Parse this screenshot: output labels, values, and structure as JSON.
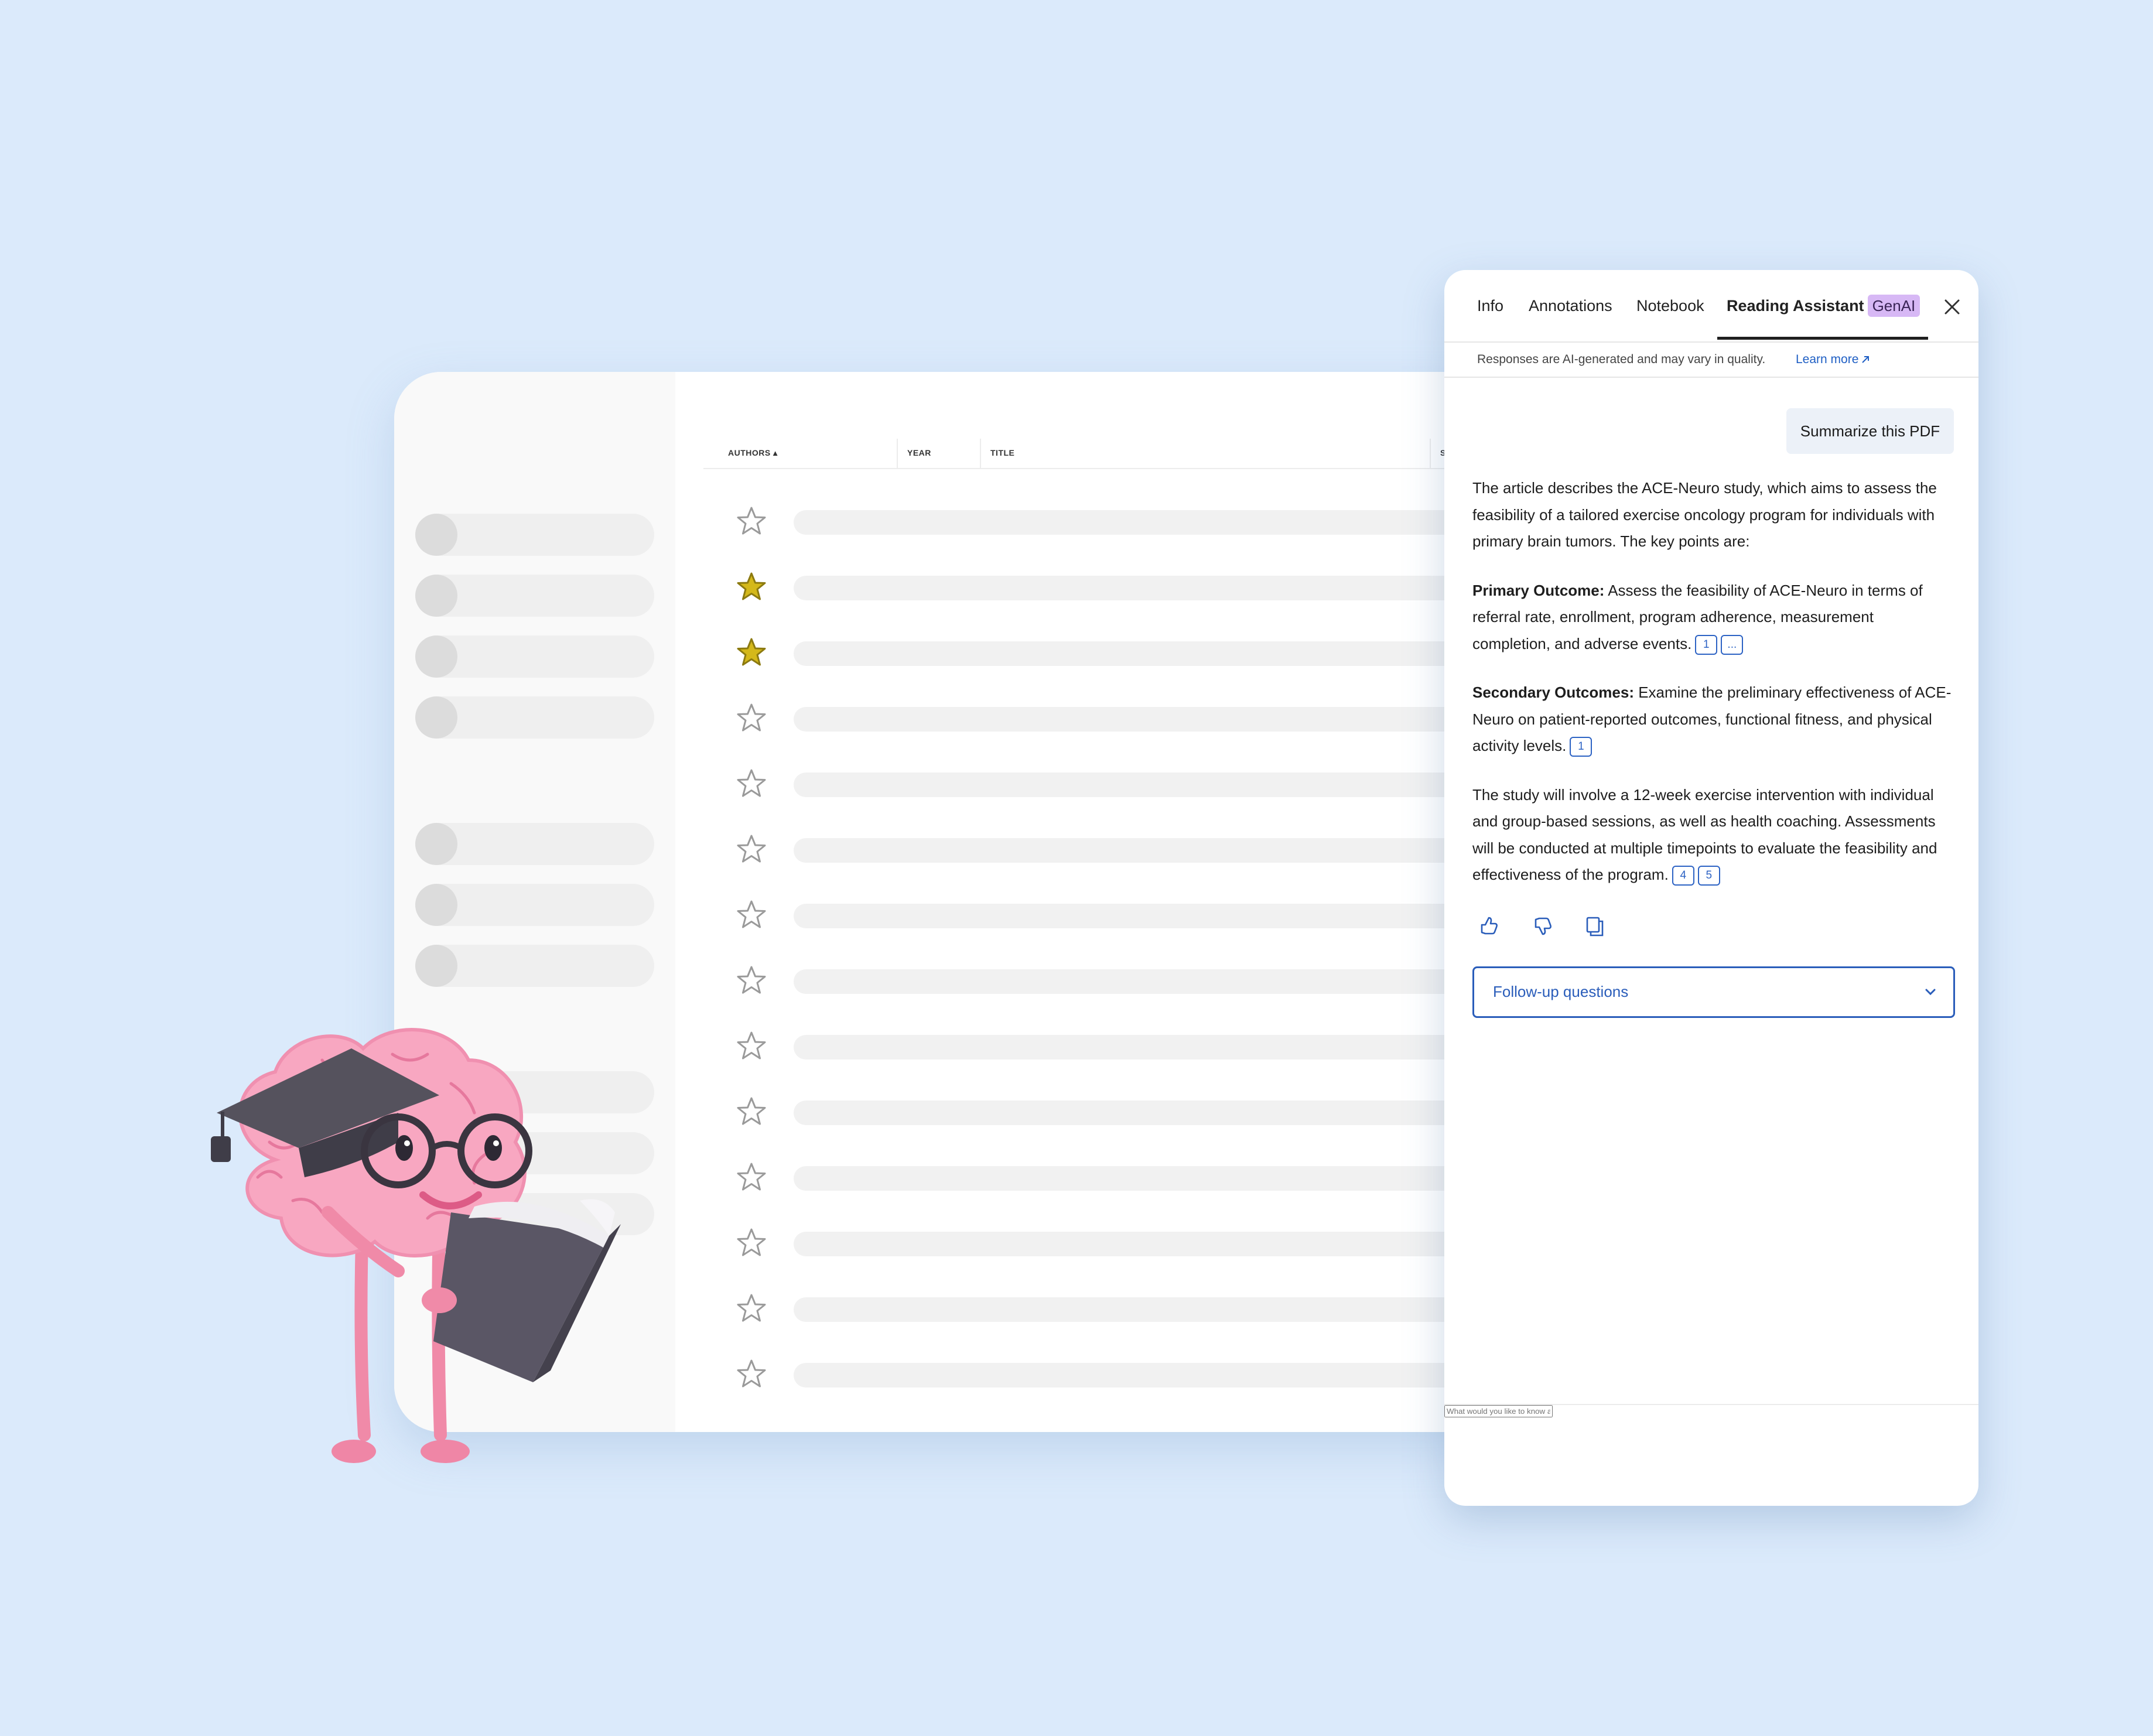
{
  "library": {
    "columns": [
      "AUTHORS ▴",
      "YEAR",
      "TITLE",
      "SOU"
    ],
    "rows": [
      {
        "starred": false
      },
      {
        "starred": true
      },
      {
        "starred": true
      },
      {
        "starred": false
      },
      {
        "starred": false
      },
      {
        "starred": false
      },
      {
        "starred": false
      },
      {
        "starred": false
      },
      {
        "starred": false
      },
      {
        "starred": false
      },
      {
        "starred": false
      },
      {
        "starred": false
      },
      {
        "starred": false
      },
      {
        "starred": false
      }
    ],
    "star_color": "#d4b81a"
  },
  "panel": {
    "tabs": [
      {
        "label": "Info"
      },
      {
        "label": "Annotations"
      },
      {
        "label": "Notebook"
      },
      {
        "label": "Reading Assistant",
        "badge": "GenAI",
        "active": true
      }
    ],
    "disclaimer": "Responses are AI-generated and may vary in quality.",
    "learn_more": "Learn more",
    "summarize_button": "Summarize this PDF",
    "answer": {
      "intro": "The article describes the ACE-Neuro study, which aims to assess the feasibility of a tailored exercise oncology program for individuals with primary brain tumors. The key points are:",
      "primary_label": "Primary Outcome:",
      "primary_text": " Assess the feasibility of ACE-Neuro in terms of referral rate, enrollment, program adherence, measurement completion, and adverse events.",
      "primary_cites": [
        "1",
        "..."
      ],
      "secondary_label": "Secondary Outcomes:",
      "secondary_text": " Examine the preliminary effectiveness of ACE-Neuro on patient-reported outcomes, functional fitness, and physical activity levels.",
      "secondary_cites": [
        "1"
      ],
      "closing": "The study will involve a 12-week exercise intervention with individual and group-based sessions, as well as health coaching. Assessments will be conducted at multiple timepoints to evaluate the feasibility and effectiveness of the program.",
      "closing_cites": [
        "4",
        "5"
      ]
    },
    "feedback_icons": [
      "thumbs-up-icon",
      "thumbs-down-icon",
      "copy-icon"
    ],
    "followup_label": "Follow-up questions",
    "question_placeholder": "What would you like to know about this publication?",
    "accent_color": "#2a5dba",
    "badge_color": "#d7b8f5"
  }
}
